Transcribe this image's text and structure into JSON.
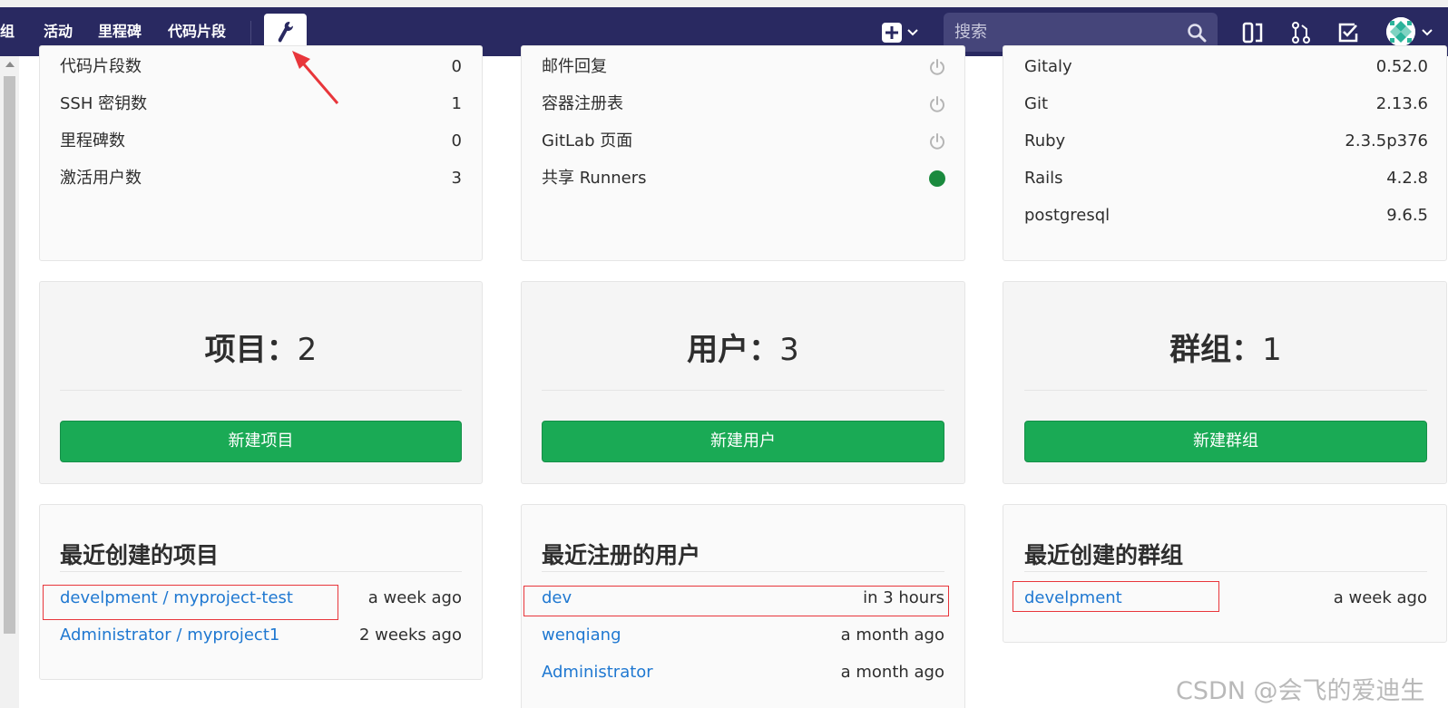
{
  "nav": {
    "items": [
      "组",
      "活动",
      "里程碑",
      "代码片段"
    ],
    "search_placeholder": "搜索"
  },
  "stats_panel": {
    "rows": [
      {
        "label": "代码片段数",
        "value": "0"
      },
      {
        "label": "SSH 密钥数",
        "value": "1"
      },
      {
        "label": "里程碑数",
        "value": "0"
      },
      {
        "label": "激活用户数",
        "value": "3"
      }
    ]
  },
  "features_panel": {
    "rows": [
      {
        "label": "邮件回复",
        "status": "off"
      },
      {
        "label": "容器注册表",
        "status": "off"
      },
      {
        "label": "GitLab 页面",
        "status": "off"
      },
      {
        "label": "共享 Runners",
        "status": "on"
      }
    ]
  },
  "components_panel": {
    "rows": [
      {
        "label": "Gitaly",
        "value": "0.52.0"
      },
      {
        "label": "Git",
        "value": "2.13.6"
      },
      {
        "label": "Ruby",
        "value": "2.3.5p376"
      },
      {
        "label": "Rails",
        "value": "4.2.8"
      },
      {
        "label": "postgresql",
        "value": "9.6.5"
      }
    ]
  },
  "counts": {
    "projects": {
      "label": "项目：",
      "value": "2",
      "button": "新建项目"
    },
    "users": {
      "label": "用户：",
      "value": "3",
      "button": "新建用户"
    },
    "groups": {
      "label": "群组：",
      "value": "1",
      "button": "新建群组"
    }
  },
  "recent_projects": {
    "title": "最近创建的项目",
    "items": [
      {
        "name": "develpment / myproject-test",
        "time": "a week ago"
      },
      {
        "name": "Administrator / myproject1",
        "time": "2 weeks ago"
      }
    ]
  },
  "recent_users": {
    "title": "最近注册的用户",
    "items": [
      {
        "name": "dev",
        "time": "in 3 hours"
      },
      {
        "name": "wenqiang",
        "time": "a month ago"
      },
      {
        "name": "Administrator",
        "time": "a month ago"
      }
    ]
  },
  "recent_groups": {
    "title": "最近创建的群组",
    "items": [
      {
        "name": "develpment",
        "time": "a week ago"
      }
    ]
  },
  "watermark": "CSDN @会飞的爱迪生",
  "colors": {
    "navbar": "#292961",
    "green_button": "#1aaa55",
    "link": "#1f78d1",
    "annotation": "#e8363b"
  }
}
